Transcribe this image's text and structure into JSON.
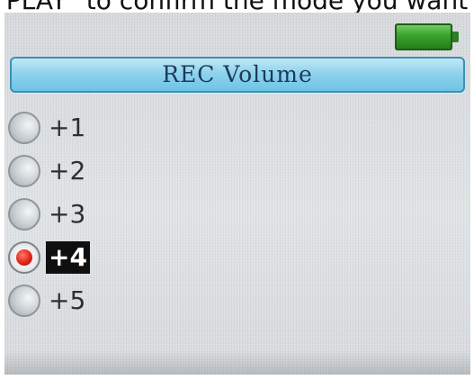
{
  "caption": {
    "text": "PLAY\" to confirm the mode you want"
  },
  "status": {
    "battery_icon": "battery-full-icon",
    "battery_color": "#3aa22d"
  },
  "header": {
    "title": "REC Volume",
    "bar_color": "#8fd3ec",
    "text_color": "#1b3a5a"
  },
  "options": [
    {
      "label": "+1",
      "selected": false
    },
    {
      "label": "+2",
      "selected": false
    },
    {
      "label": "+3",
      "selected": false
    },
    {
      "label": "+4",
      "selected": true
    },
    {
      "label": "+5",
      "selected": false
    }
  ],
  "colors": {
    "screen_bg": "#d9dde0",
    "selected_radio": "#e2231a",
    "highlight_bg": "#0f0f0f"
  }
}
